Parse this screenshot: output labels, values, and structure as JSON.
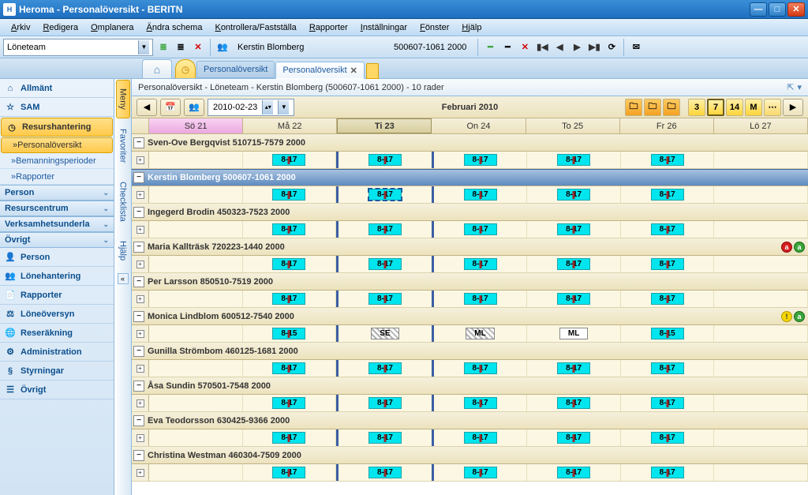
{
  "title": "Heroma - Personalöversikt - BERITN",
  "menus": [
    "Arkiv",
    "Redigera",
    "Omplanera",
    "Ändra schema",
    "Kontrollera/Fastställa",
    "Rapporter",
    "Inställningar",
    "Fönster",
    "Hjälp"
  ],
  "toolbar": {
    "team": "Löneteam",
    "person_name": "Kerstin Blomberg",
    "person_id": "500607-1061 2000"
  },
  "tabs": {
    "t1": "Personalöversikt",
    "t2": "Personalöversikt"
  },
  "sidebar": {
    "allmant": "Allmänt",
    "sam": "SAM",
    "resurshantering": "Resurshantering",
    "sub_personaloversikt": "Personalöversikt",
    "sub_bemanning": "Bemanningsperioder",
    "sub_rapporter": "Rapporter",
    "sec_person": "Person",
    "sec_resurscentrum": "Resurscentrum",
    "sec_verksam": "Verksamhetsunderla",
    "sec_ovrigt": "Övrigt",
    "g_person": "Person",
    "g_lonehantering": "Lönehantering",
    "g_rapporter": "Rapporter",
    "g_loneoversyn": "Löneöversyn",
    "g_reserakning": "Reseräkning",
    "g_administration": "Administration",
    "g_styrningar": "Styrningar",
    "g_ovrigt": "Övrigt"
  },
  "vtabs": {
    "meny": "Meny",
    "favoriter": "Favoriter",
    "checklista": "Checklista",
    "hjalp": "Hjälp"
  },
  "crumb": "Personalöversikt - Löneteam - Kerstin Blomberg (500607-1061 2000) - 10 rader",
  "datebox": "2010-02-23",
  "month": "Februari 2010",
  "view_buttons": [
    "3",
    "7",
    "14",
    "M"
  ],
  "days": [
    {
      "label": "Sö 21",
      "type": "sun"
    },
    {
      "label": "Må 22",
      "type": ""
    },
    {
      "label": "Ti 23",
      "type": "today"
    },
    {
      "label": "On 24",
      "type": ""
    },
    {
      "label": "To 25",
      "type": ""
    },
    {
      "label": "Fr 26",
      "type": ""
    },
    {
      "label": "Lö 27",
      "type": ""
    }
  ],
  "people": [
    {
      "name": "Sven-Ove  Bergqvist  510715-7579 2000",
      "sel": false,
      "badges": [],
      "shifts": [
        "",
        "8-17",
        "8-17",
        "8-17",
        "8-17",
        "8-17",
        ""
      ]
    },
    {
      "name": "Kerstin  Blomberg  500607-1061 2000",
      "sel": true,
      "badges": [],
      "shifts": [
        "",
        "8-17",
        "8-17*",
        "8-17",
        "8-17",
        "8-17",
        ""
      ]
    },
    {
      "name": "Ingegerd  Brodin  450323-7523 2000",
      "sel": false,
      "badges": [],
      "shifts": [
        "",
        "8-17",
        "8-17",
        "8-17",
        "8-17",
        "8-17",
        ""
      ]
    },
    {
      "name": "Maria  Kallträsk  720223-1440 2000",
      "sel": false,
      "badges": [
        "red",
        "grn"
      ],
      "shifts": [
        "",
        "8-17",
        "8-17",
        "8-17",
        "8-17",
        "8-17",
        ""
      ]
    },
    {
      "name": "Per  Larsson  850510-7519 2000",
      "sel": false,
      "badges": [],
      "shifts": [
        "",
        "8-17",
        "8-17",
        "8-17",
        "8-17",
        "8-17",
        ""
      ]
    },
    {
      "name": "Monica  Lindblom  600512-7540 2000",
      "sel": false,
      "badges": [
        "yel2",
        "grn"
      ],
      "shifts": [
        "",
        "8-15",
        "SE#",
        "ML#",
        "ML^",
        "8-15",
        ""
      ]
    },
    {
      "name": "Gunilla  Strömbom  460125-1681 2000",
      "sel": false,
      "badges": [],
      "shifts": [
        "",
        "8-17",
        "8-17",
        "8-17",
        "8-17",
        "8-17",
        ""
      ]
    },
    {
      "name": "Åsa  Sundin  570501-7548 2000",
      "sel": false,
      "badges": [],
      "shifts": [
        "",
        "8-17",
        "8-17",
        "8-17",
        "8-17",
        "8-17",
        ""
      ]
    },
    {
      "name": "Eva  Teodorsson  630425-9366 2000",
      "sel": false,
      "badges": [],
      "shifts": [
        "",
        "8-17",
        "8-17",
        "8-17",
        "8-17",
        "8-17",
        ""
      ]
    },
    {
      "name": "Christina  Westman  460304-7509 2000",
      "sel": false,
      "badges": [],
      "shifts": [
        "",
        "8-17",
        "8-17",
        "8-17",
        "8-17",
        "8-17",
        ""
      ]
    }
  ]
}
